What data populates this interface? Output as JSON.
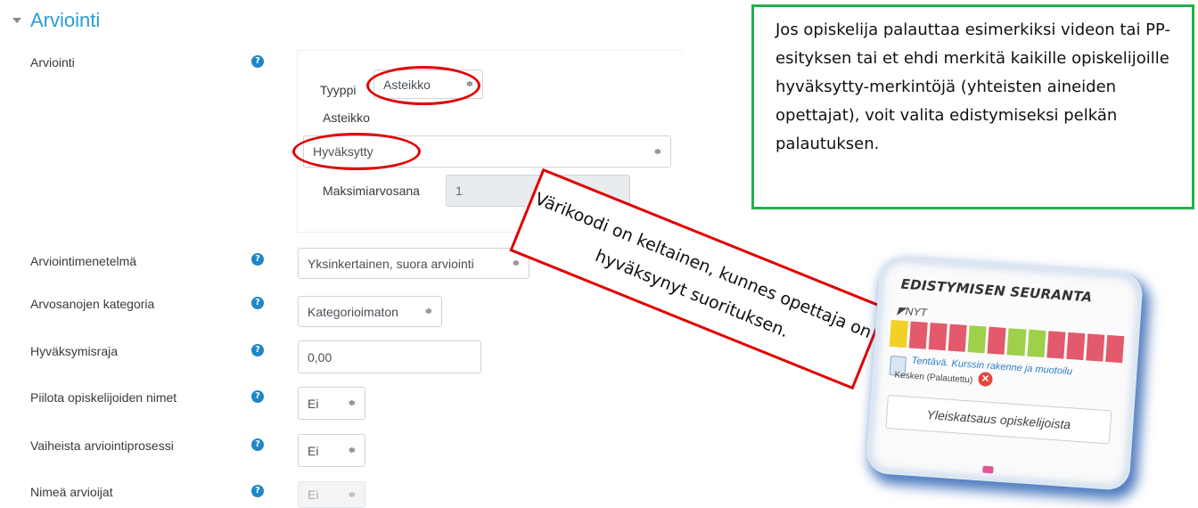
{
  "section": {
    "title": "Arviointi"
  },
  "fields": {
    "grade": {
      "label": "Arviointi"
    },
    "type": {
      "label": "Tyyppi",
      "value": "Asteikko"
    },
    "scale": {
      "label": "Asteikko",
      "value": "Hyväksytty"
    },
    "maxgrade": {
      "label": "Maksimiarvosana",
      "value": "1"
    },
    "method": {
      "label": "Arviointimenetelmä",
      "value": "Yksinkertainen, suora arviointi"
    },
    "category": {
      "label": "Arvosanojen kategoria",
      "value": "Kategorioimaton"
    },
    "passgrade": {
      "label": "Hyväksymisraja",
      "value": "0,00"
    },
    "hidenames": {
      "label": "Piilota opiskelijoiden nimet",
      "value": "Ei"
    },
    "workflow": {
      "label": "Vaiheista arviointiprosessi",
      "value": "Ei"
    },
    "allocation": {
      "label": "Nimeä arvioijat",
      "value": "Ei"
    }
  },
  "help_icon": {
    "glyph": "?",
    "icon": "question-circle-icon",
    "color": "#1f86c7"
  },
  "select_arrow": "≑",
  "callouts": {
    "green": "Jos opiskelija palauttaa esimerkiksi videon tai PP-esityksen tai et ehdi merkitä kaikille opiskelijoille hyväksytty-merkintöjä (yhteisten aineiden opettajat), voit valita edistymiseksi pelkän palautuksen.",
    "red": "Värikoodi on keltainen, kunnes opettaja on hyväksynyt suorituksen."
  },
  "progress_widget": {
    "title": "EDISTYMISEN SEURANTA",
    "now_label": "NYT",
    "segments": [
      "#f2d026",
      "#e25a6b",
      "#e25a6b",
      "#e25a6b",
      "#9fd04a",
      "#e25a6b",
      "#9fd04a",
      "#9fd04a",
      "#e25a6b",
      "#e25a6b",
      "#e25a6b",
      "#e25a6b"
    ],
    "task": "Tentävä. Kurssin rakenne ja muotoilu",
    "status": "Kesken (Palautettu)",
    "button": "Yleiskatsaus opiskelijoista"
  },
  "colors": {
    "accent": "#2b9bd6",
    "red_callout": "#e00000",
    "green_callout": "#22b14c"
  }
}
